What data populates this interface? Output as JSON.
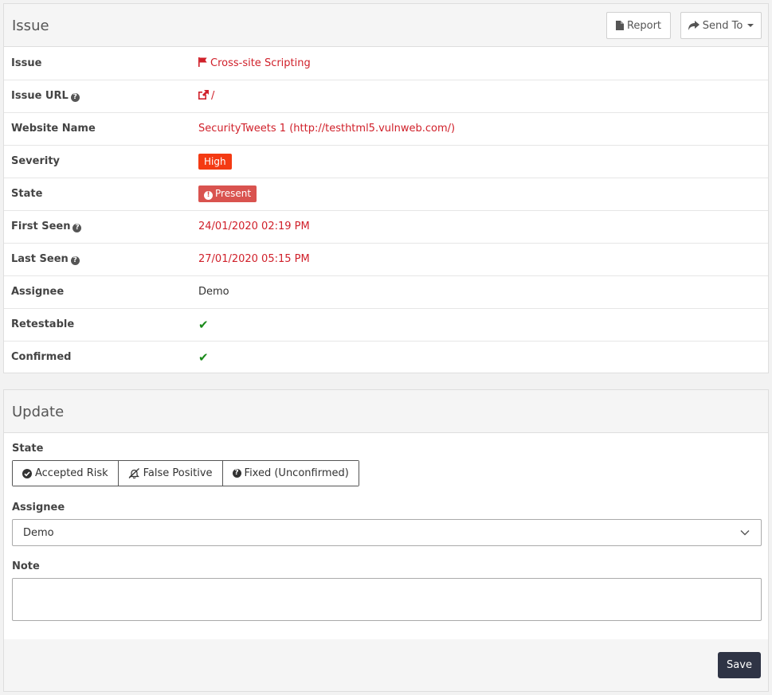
{
  "issue_panel": {
    "title": "Issue",
    "report_label": "Report",
    "send_to_label": "Send To"
  },
  "details": {
    "issue_label": "Issue",
    "issue_value": "Cross-site Scripting",
    "issue_url_label": "Issue URL",
    "issue_url_value": "/",
    "website_label": "Website Name",
    "website_value": "SecurityTweets 1 (http://testhtml5.vulnweb.com/)",
    "severity_label": "Severity",
    "severity_value": "High",
    "state_label": "State",
    "state_value": "Present",
    "first_seen_label": "First Seen",
    "first_seen_value": "24/01/2020 02:19 PM",
    "last_seen_label": "Last Seen",
    "last_seen_value": "27/01/2020 05:15 PM",
    "assignee_label": "Assignee",
    "assignee_value": "Demo",
    "retestable_label": "Retestable",
    "retestable_value": true,
    "confirmed_label": "Confirmed",
    "confirmed_value": true
  },
  "update_panel": {
    "title": "Update",
    "state_label": "State",
    "state_options": [
      "Accepted Risk",
      "False Positive",
      "Fixed (Unconfirmed)"
    ],
    "assignee_label": "Assignee",
    "assignee_selected": "Demo",
    "note_label": "Note",
    "note_value": "",
    "save_label": "Save"
  },
  "colors": {
    "link_red": "#d0202a",
    "severity_high": "#f43a13",
    "state_present": "#d9534f",
    "check_green": "#1a8a1a",
    "save_button": "#2f3445"
  },
  "icons": {
    "report": "file-icon",
    "send_to": "share-arrow-icon",
    "issue": "flag-icon",
    "issue_url": "external-link-icon",
    "help": "question-circle-icon",
    "present": "exclamation-circle-icon",
    "check": "check-icon",
    "accepted_risk": "check-circle-icon",
    "false_positive": "bell-slash-icon",
    "fixed": "question-circle-icon",
    "select": "chevron-down-icon"
  }
}
